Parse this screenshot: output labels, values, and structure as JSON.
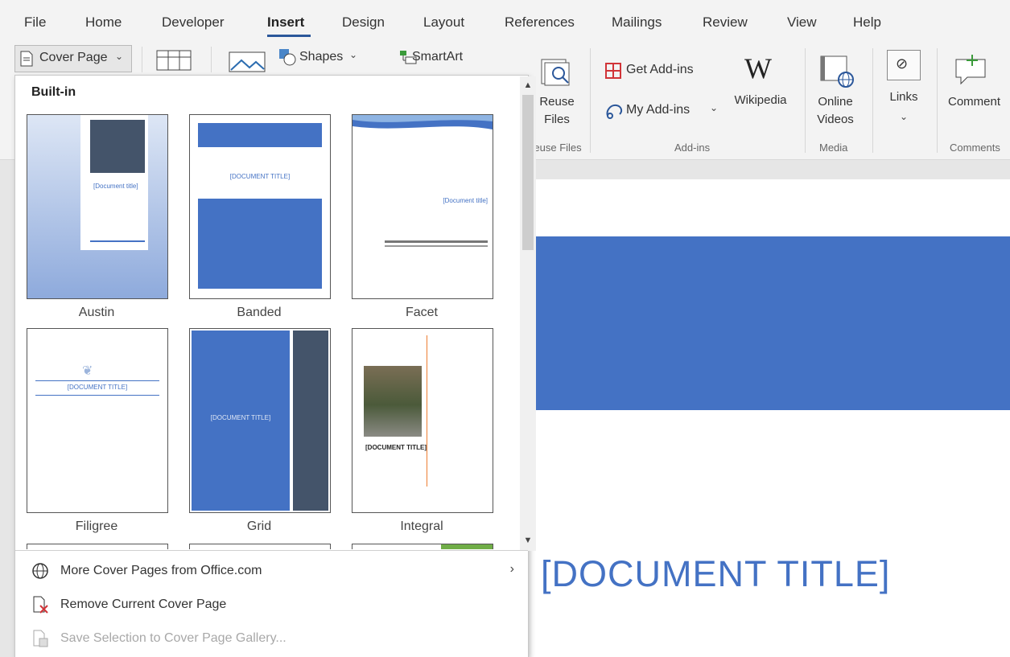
{
  "menu": {
    "items": [
      "File",
      "Home",
      "Developer",
      "Insert",
      "Design",
      "Layout",
      "References",
      "Mailings",
      "Review",
      "View",
      "Help"
    ],
    "active": "Insert"
  },
  "ribbon": {
    "cover_page": "Cover Page",
    "shapes": "Shapes",
    "smartart": "SmartArt",
    "reuse_files_l1": "Reuse",
    "reuse_files_l2": "Files",
    "reuse_group": "Reuse Files",
    "get_addins": "Get Add-ins",
    "my_addins": "My Add-ins",
    "wikipedia": "Wikipedia",
    "addins_group": "Add-ins",
    "online_videos_l1": "Online",
    "online_videos_l2": "Videos",
    "media_group": "Media",
    "links": "Links",
    "comment": "Comment",
    "comments_group": "Comments"
  },
  "gallery": {
    "heading": "Built-in",
    "templates": [
      {
        "name": "Austin"
      },
      {
        "name": "Banded"
      },
      {
        "name": "Facet"
      },
      {
        "name": "Filigree"
      },
      {
        "name": "Grid"
      },
      {
        "name": "Integral"
      }
    ],
    "thumb_text": {
      "austin_title": "[Document title]",
      "banded_title": "[DOCUMENT TITLE]",
      "facet_title": "[Document title]",
      "filigree_title": "[DOCUMENT TITLE]",
      "grid_title": "[DOCUMENT TITLE]",
      "integral_title": "[DOCUMENT TITLE]"
    }
  },
  "footer": {
    "more": "More Cover Pages from Office.com",
    "remove": "Remove Current Cover Page",
    "save": "Save Selection to Cover Page Gallery..."
  },
  "document": {
    "title": "[DOCUMENT TITLE]"
  },
  "colors": {
    "accent": "#4472c4",
    "ribbon_accent": "#2b579a",
    "grid_dark": "#44546a"
  }
}
